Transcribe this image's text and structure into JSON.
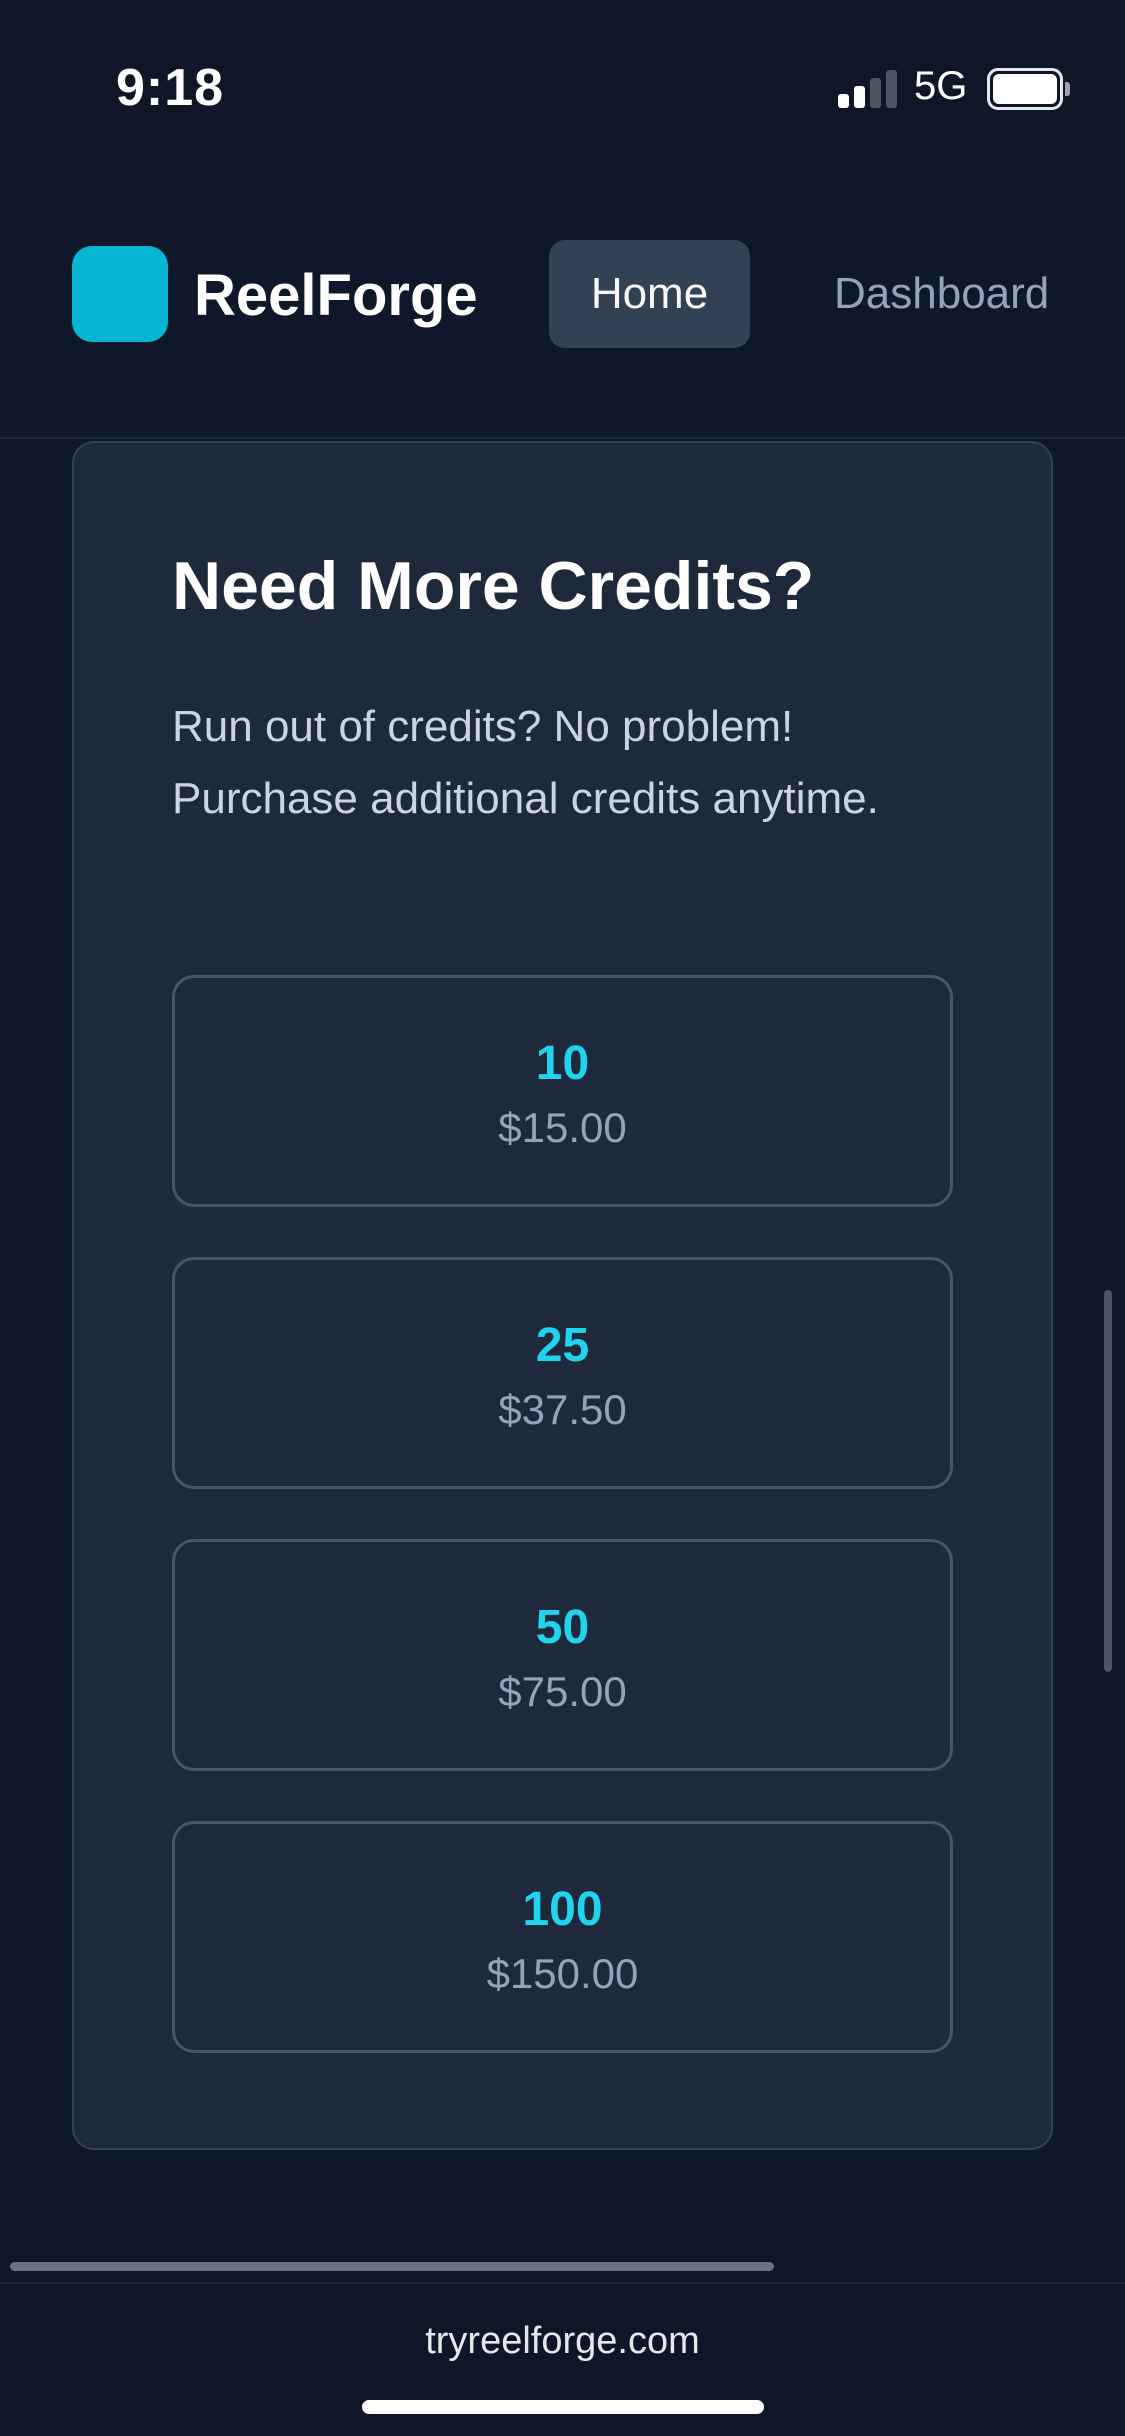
{
  "status_bar": {
    "time": "9:18",
    "network": "5G",
    "signal_icon": "signal-bars-icon",
    "battery_icon": "battery-full-icon"
  },
  "header": {
    "logo_icon": "brand-square-icon",
    "brand": "ReelForge",
    "nav": {
      "home": "Home",
      "dashboard": "Dashboard"
    },
    "accent_color": "#06b6d4"
  },
  "credits_section": {
    "title": "Need More Credits?",
    "description": "Run out of credits? No problem! Purchase additional credits anytime.",
    "packages": [
      {
        "credits": "10",
        "price": "$15.00"
      },
      {
        "credits": "25",
        "price": "$37.50"
      },
      {
        "credits": "50",
        "price": "$75.00"
      },
      {
        "credits": "100",
        "price": "$150.00"
      }
    ]
  },
  "browser": {
    "url": "tryreelforge.com"
  },
  "colors": {
    "background": "#0f172a",
    "card": "#1e293b",
    "credits_text": "#22d3ee",
    "price_text": "#94a3b8"
  }
}
